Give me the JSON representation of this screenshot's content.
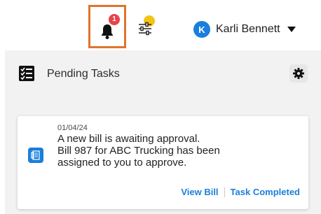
{
  "header": {
    "notifications": {
      "icon": "bell-icon",
      "badge_count": "1",
      "badge_color": "#e8434a",
      "highlight_color": "#e0742c"
    },
    "filter": {
      "icon": "sliders-icon",
      "dot_color": "#f3c316"
    },
    "user": {
      "avatar_initial": "K",
      "name": "Karli Bennett",
      "avatar_color": "#1a7fdc"
    }
  },
  "panel": {
    "title": "Pending Tasks",
    "icon": "checklist-icon",
    "settings_icon": "gear-icon"
  },
  "task_card": {
    "icon": "bill-icon",
    "date": "01/04/24",
    "message_line1": "A new bill is awaiting approval.",
    "message_line2": "Bill 987 for ABC Trucking has been",
    "message_line3": "assigned to you to approve.",
    "actions": {
      "view": "View Bill",
      "complete": "Task Completed"
    },
    "accent_color": "#1a7fdc"
  }
}
